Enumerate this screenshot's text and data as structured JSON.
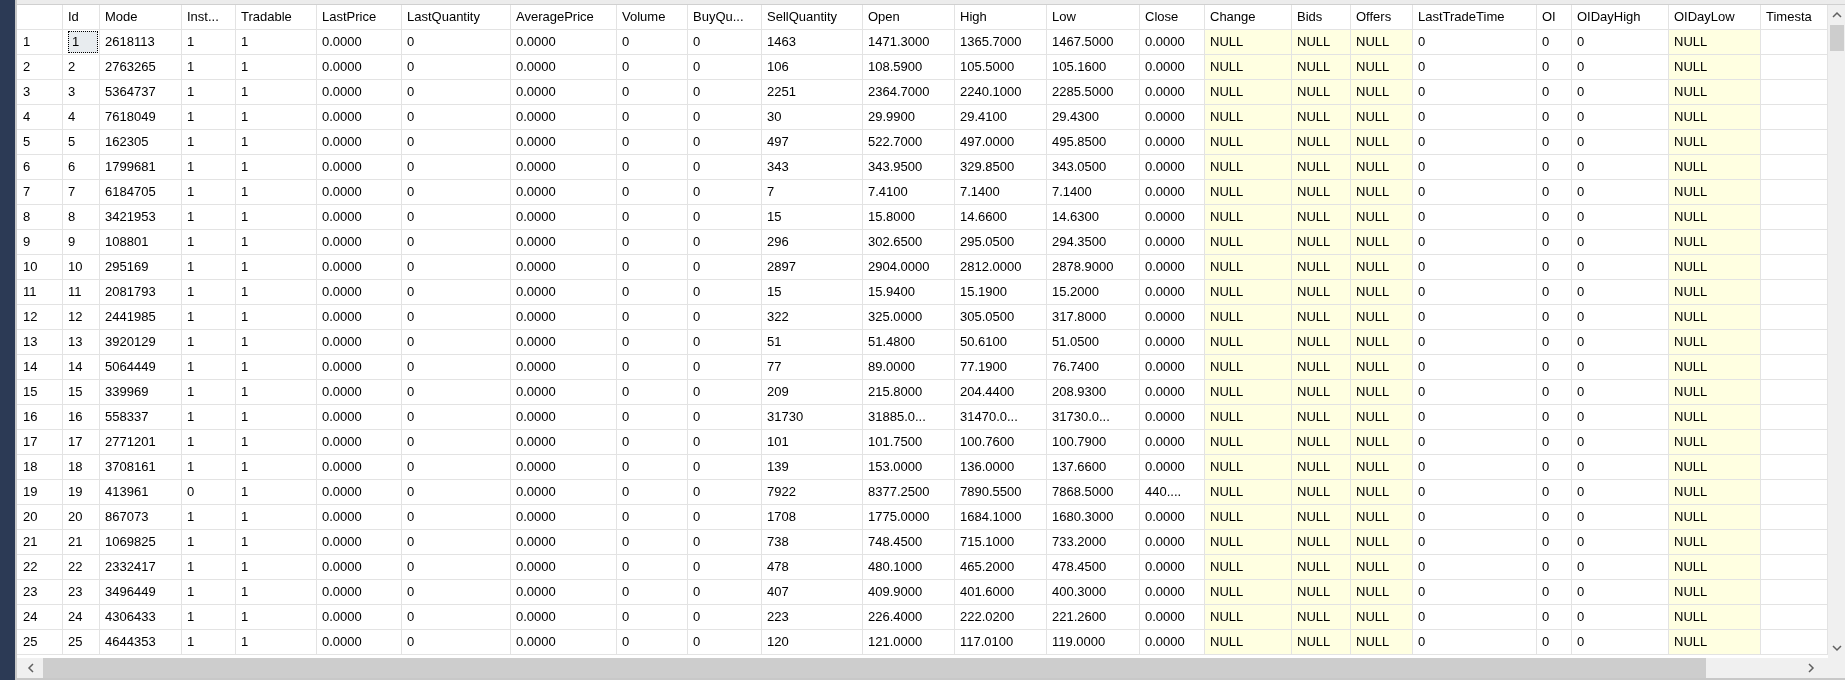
{
  "columns": [
    {
      "label": "Id",
      "null_shaded": false
    },
    {
      "label": "Mode",
      "null_shaded": false
    },
    {
      "label": "Inst...",
      "null_shaded": false
    },
    {
      "label": "Tradable",
      "null_shaded": false
    },
    {
      "label": "LastPrice",
      "null_shaded": false
    },
    {
      "label": "LastQuantity",
      "null_shaded": false
    },
    {
      "label": "AveragePrice",
      "null_shaded": false
    },
    {
      "label": "Volume",
      "null_shaded": false
    },
    {
      "label": "BuyQu...",
      "null_shaded": false
    },
    {
      "label": "SellQuantity",
      "null_shaded": false
    },
    {
      "label": "Open",
      "null_shaded": false
    },
    {
      "label": "High",
      "null_shaded": false
    },
    {
      "label": "Low",
      "null_shaded": false
    },
    {
      "label": "Close",
      "null_shaded": false
    },
    {
      "label": "Change",
      "null_shaded": true
    },
    {
      "label": "Bids",
      "null_shaded": true
    },
    {
      "label": "Offers",
      "null_shaded": true
    },
    {
      "label": "LastTradeTime",
      "null_shaded": false
    },
    {
      "label": "OI",
      "null_shaded": false
    },
    {
      "label": "OIDayHigh",
      "null_shaded": false
    },
    {
      "label": "OIDayLow",
      "null_shaded": true
    },
    {
      "label": "Timesta",
      "null_shaded": false
    }
  ],
  "rows": [
    {
      "number": "1",
      "focused": true,
      "cells": [
        "1",
        "2618113",
        "1",
        "1",
        "0.0000",
        "0",
        "0.0000",
        "0",
        "0",
        "1463",
        "1471.3000",
        "1365.7000",
        "1467.5000",
        "0.0000",
        "NULL",
        "NULL",
        "NULL",
        "0",
        "0",
        "0",
        "NULL"
      ]
    },
    {
      "number": "2",
      "focused": false,
      "cells": [
        "2",
        "2763265",
        "1",
        "1",
        "0.0000",
        "0",
        "0.0000",
        "0",
        "0",
        "106",
        "108.5900",
        "105.5000",
        "105.1600",
        "0.0000",
        "NULL",
        "NULL",
        "NULL",
        "0",
        "0",
        "0",
        "NULL"
      ]
    },
    {
      "number": "3",
      "focused": false,
      "cells": [
        "3",
        "5364737",
        "1",
        "1",
        "0.0000",
        "0",
        "0.0000",
        "0",
        "0",
        "2251",
        "2364.7000",
        "2240.1000",
        "2285.5000",
        "0.0000",
        "NULL",
        "NULL",
        "NULL",
        "0",
        "0",
        "0",
        "NULL"
      ]
    },
    {
      "number": "4",
      "focused": false,
      "cells": [
        "4",
        "7618049",
        "1",
        "1",
        "0.0000",
        "0",
        "0.0000",
        "0",
        "0",
        "30",
        "29.9900",
        "29.4100",
        "29.4300",
        "0.0000",
        "NULL",
        "NULL",
        "NULL",
        "0",
        "0",
        "0",
        "NULL"
      ]
    },
    {
      "number": "5",
      "focused": false,
      "cells": [
        "5",
        "162305",
        "1",
        "1",
        "0.0000",
        "0",
        "0.0000",
        "0",
        "0",
        "497",
        "522.7000",
        "497.0000",
        "495.8500",
        "0.0000",
        "NULL",
        "NULL",
        "NULL",
        "0",
        "0",
        "0",
        "NULL"
      ]
    },
    {
      "number": "6",
      "focused": false,
      "cells": [
        "6",
        "1799681",
        "1",
        "1",
        "0.0000",
        "0",
        "0.0000",
        "0",
        "0",
        "343",
        "343.9500",
        "329.8500",
        "343.0500",
        "0.0000",
        "NULL",
        "NULL",
        "NULL",
        "0",
        "0",
        "0",
        "NULL"
      ]
    },
    {
      "number": "7",
      "focused": false,
      "cells": [
        "7",
        "6184705",
        "1",
        "1",
        "0.0000",
        "0",
        "0.0000",
        "0",
        "0",
        "7",
        "7.4100",
        "7.1400",
        "7.1400",
        "0.0000",
        "NULL",
        "NULL",
        "NULL",
        "0",
        "0",
        "0",
        "NULL"
      ]
    },
    {
      "number": "8",
      "focused": false,
      "cells": [
        "8",
        "3421953",
        "1",
        "1",
        "0.0000",
        "0",
        "0.0000",
        "0",
        "0",
        "15",
        "15.8000",
        "14.6600",
        "14.6300",
        "0.0000",
        "NULL",
        "NULL",
        "NULL",
        "0",
        "0",
        "0",
        "NULL"
      ]
    },
    {
      "number": "9",
      "focused": false,
      "cells": [
        "9",
        "108801",
        "1",
        "1",
        "0.0000",
        "0",
        "0.0000",
        "0",
        "0",
        "296",
        "302.6500",
        "295.0500",
        "294.3500",
        "0.0000",
        "NULL",
        "NULL",
        "NULL",
        "0",
        "0",
        "0",
        "NULL"
      ]
    },
    {
      "number": "10",
      "focused": false,
      "cells": [
        "10",
        "295169",
        "1",
        "1",
        "0.0000",
        "0",
        "0.0000",
        "0",
        "0",
        "2897",
        "2904.0000",
        "2812.0000",
        "2878.9000",
        "0.0000",
        "NULL",
        "NULL",
        "NULL",
        "0",
        "0",
        "0",
        "NULL"
      ]
    },
    {
      "number": "11",
      "focused": false,
      "cells": [
        "11",
        "2081793",
        "1",
        "1",
        "0.0000",
        "0",
        "0.0000",
        "0",
        "0",
        "15",
        "15.9400",
        "15.1900",
        "15.2000",
        "0.0000",
        "NULL",
        "NULL",
        "NULL",
        "0",
        "0",
        "0",
        "NULL"
      ]
    },
    {
      "number": "12",
      "focused": false,
      "cells": [
        "12",
        "2441985",
        "1",
        "1",
        "0.0000",
        "0",
        "0.0000",
        "0",
        "0",
        "322",
        "325.0000",
        "305.0500",
        "317.8000",
        "0.0000",
        "NULL",
        "NULL",
        "NULL",
        "0",
        "0",
        "0",
        "NULL"
      ]
    },
    {
      "number": "13",
      "focused": false,
      "cells": [
        "13",
        "3920129",
        "1",
        "1",
        "0.0000",
        "0",
        "0.0000",
        "0",
        "0",
        "51",
        "51.4800",
        "50.6100",
        "51.0500",
        "0.0000",
        "NULL",
        "NULL",
        "NULL",
        "0",
        "0",
        "0",
        "NULL"
      ]
    },
    {
      "number": "14",
      "focused": false,
      "cells": [
        "14",
        "5064449",
        "1",
        "1",
        "0.0000",
        "0",
        "0.0000",
        "0",
        "0",
        "77",
        "89.0000",
        "77.1900",
        "76.7400",
        "0.0000",
        "NULL",
        "NULL",
        "NULL",
        "0",
        "0",
        "0",
        "NULL"
      ]
    },
    {
      "number": "15",
      "focused": false,
      "cells": [
        "15",
        "339969",
        "1",
        "1",
        "0.0000",
        "0",
        "0.0000",
        "0",
        "0",
        "209",
        "215.8000",
        "204.4400",
        "208.9300",
        "0.0000",
        "NULL",
        "NULL",
        "NULL",
        "0",
        "0",
        "0",
        "NULL"
      ]
    },
    {
      "number": "16",
      "focused": false,
      "cells": [
        "16",
        "558337",
        "1",
        "1",
        "0.0000",
        "0",
        "0.0000",
        "0",
        "0",
        "31730",
        "31885.0...",
        "31470.0...",
        "31730.0...",
        "0.0000",
        "NULL",
        "NULL",
        "NULL",
        "0",
        "0",
        "0",
        "NULL"
      ]
    },
    {
      "number": "17",
      "focused": false,
      "cells": [
        "17",
        "2771201",
        "1",
        "1",
        "0.0000",
        "0",
        "0.0000",
        "0",
        "0",
        "101",
        "101.7500",
        "100.7600",
        "100.7900",
        "0.0000",
        "NULL",
        "NULL",
        "NULL",
        "0",
        "0",
        "0",
        "NULL"
      ]
    },
    {
      "number": "18",
      "focused": false,
      "cells": [
        "18",
        "3708161",
        "1",
        "1",
        "0.0000",
        "0",
        "0.0000",
        "0",
        "0",
        "139",
        "153.0000",
        "136.0000",
        "137.6600",
        "0.0000",
        "NULL",
        "NULL",
        "NULL",
        "0",
        "0",
        "0",
        "NULL"
      ]
    },
    {
      "number": "19",
      "focused": false,
      "cells": [
        "19",
        "413961",
        "0",
        "1",
        "0.0000",
        "0",
        "0.0000",
        "0",
        "0",
        "7922",
        "8377.2500",
        "7890.5500",
        "7868.5000",
        "440....",
        "NULL",
        "NULL",
        "NULL",
        "0",
        "0",
        "0",
        "NULL"
      ]
    },
    {
      "number": "20",
      "focused": false,
      "cells": [
        "20",
        "867073",
        "1",
        "1",
        "0.0000",
        "0",
        "0.0000",
        "0",
        "0",
        "1708",
        "1775.0000",
        "1684.1000",
        "1680.3000",
        "0.0000",
        "NULL",
        "NULL",
        "NULL",
        "0",
        "0",
        "0",
        "NULL"
      ]
    },
    {
      "number": "21",
      "focused": false,
      "cells": [
        "21",
        "1069825",
        "1",
        "1",
        "0.0000",
        "0",
        "0.0000",
        "0",
        "0",
        "738",
        "748.4500",
        "715.1000",
        "733.2000",
        "0.0000",
        "NULL",
        "NULL",
        "NULL",
        "0",
        "0",
        "0",
        "NULL"
      ]
    },
    {
      "number": "22",
      "focused": false,
      "cells": [
        "22",
        "2332417",
        "1",
        "1",
        "0.0000",
        "0",
        "0.0000",
        "0",
        "0",
        "478",
        "480.1000",
        "465.2000",
        "478.4500",
        "0.0000",
        "NULL",
        "NULL",
        "NULL",
        "0",
        "0",
        "0",
        "NULL"
      ]
    },
    {
      "number": "23",
      "focused": false,
      "cells": [
        "23",
        "3496449",
        "1",
        "1",
        "0.0000",
        "0",
        "0.0000",
        "0",
        "0",
        "407",
        "409.9000",
        "401.6000",
        "400.3000",
        "0.0000",
        "NULL",
        "NULL",
        "NULL",
        "0",
        "0",
        "0",
        "NULL"
      ]
    },
    {
      "number": "24",
      "focused": false,
      "cells": [
        "24",
        "4306433",
        "1",
        "1",
        "0.0000",
        "0",
        "0.0000",
        "0",
        "0",
        "223",
        "226.4000",
        "222.0200",
        "221.2600",
        "0.0000",
        "NULL",
        "NULL",
        "NULL",
        "0",
        "0",
        "0",
        "NULL"
      ]
    },
    {
      "number": "25",
      "focused": false,
      "cells": [
        "25",
        "4644353",
        "1",
        "1",
        "0.0000",
        "0",
        "0.0000",
        "0",
        "0",
        "120",
        "121.0000",
        "117.0100",
        "119.0000",
        "0.0000",
        "NULL",
        "NULL",
        "NULL",
        "0",
        "0",
        "0",
        "NULL"
      ]
    }
  ]
}
